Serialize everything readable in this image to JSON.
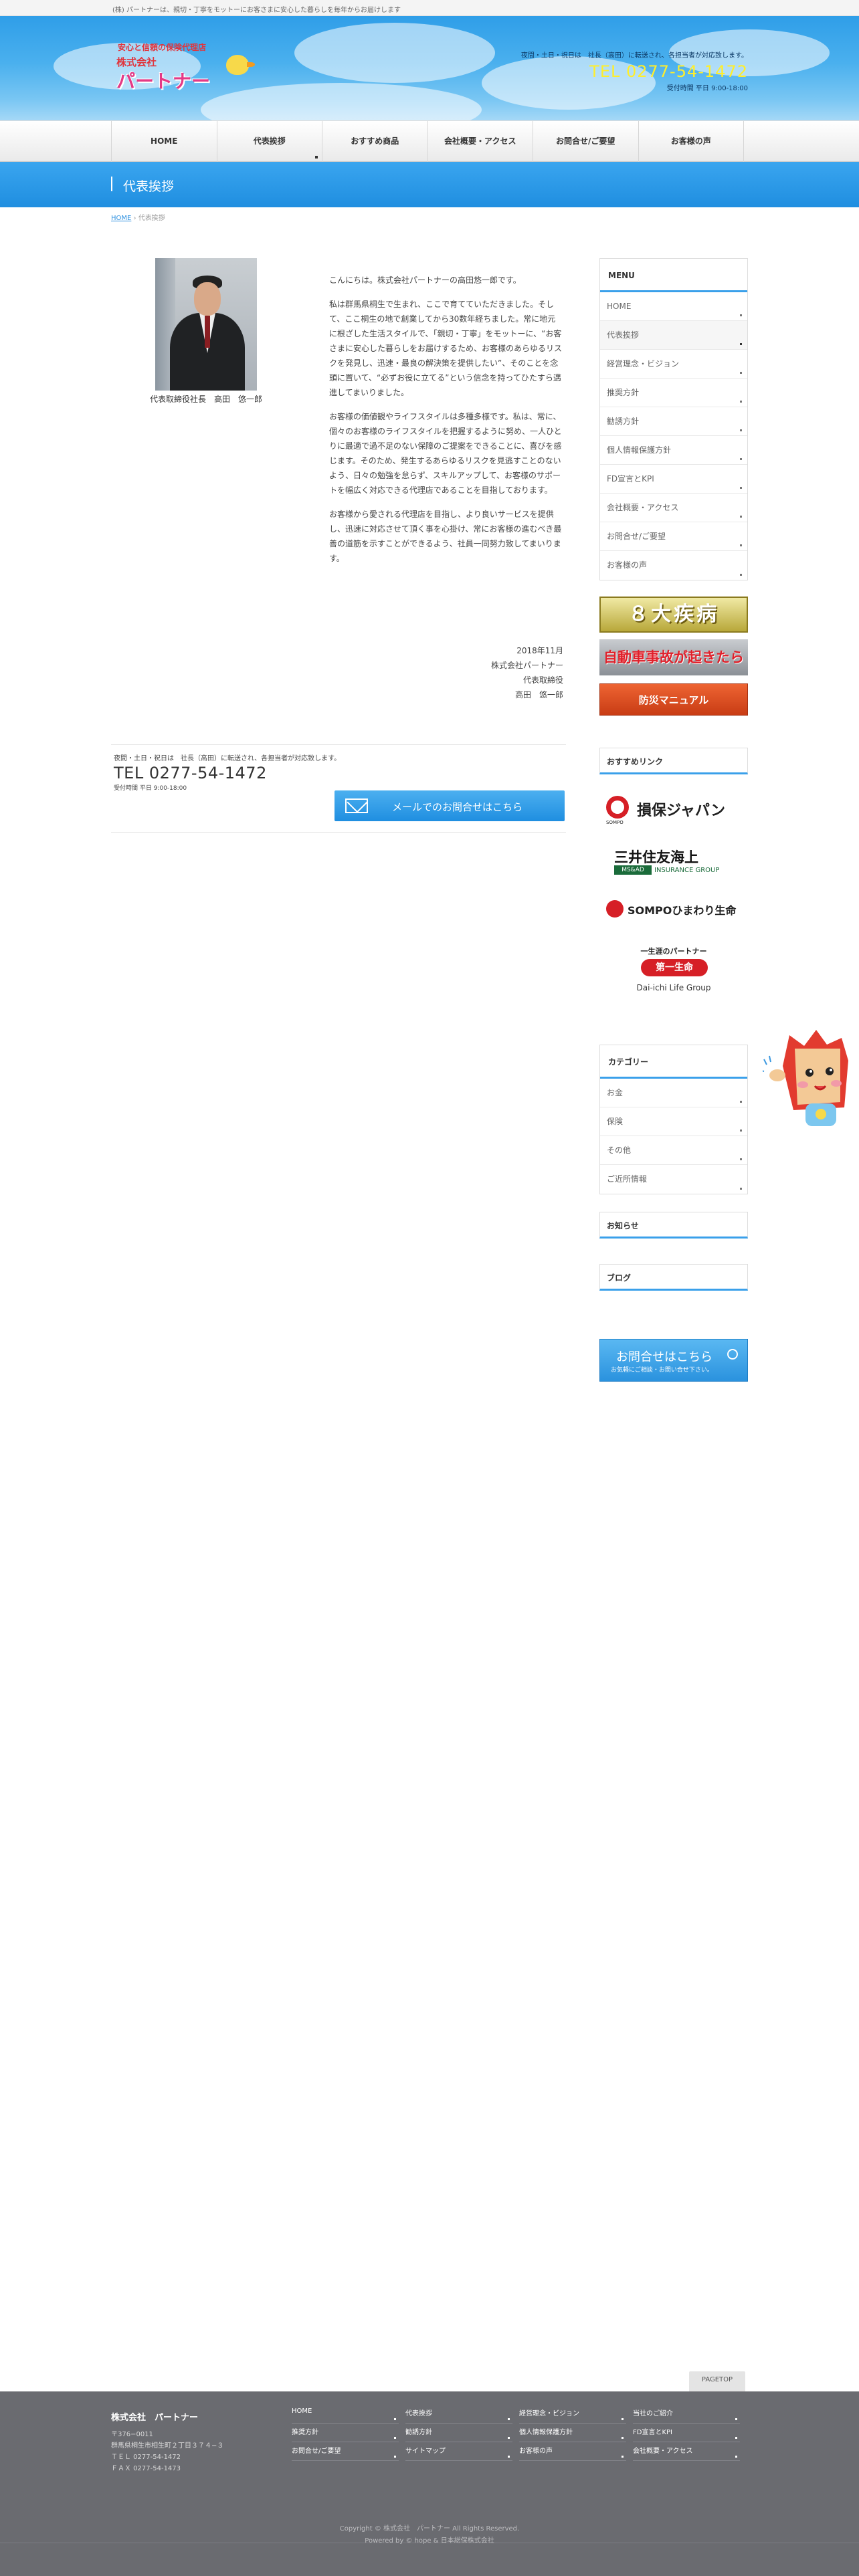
{
  "topbar": {
    "text": "(株) パートナーは、親切・丁寧をモットーにお客さまに安心した暮らしを毎年からお届けします"
  },
  "header": {
    "logo_tag1": "安心と信頼の保険代理店",
    "logo_tag2": "株式会社",
    "logo_name": "パートナー",
    "notice": "夜間・土日・祝日は　社長（高田）に転送され、各担当者が対応致します。",
    "tel": "TEL 0277-54-1472",
    "hours": "受付時間 平日 9:00-18:00"
  },
  "nav": {
    "items": [
      {
        "label": "HOME"
      },
      {
        "label": "代表挨拶"
      },
      {
        "label": "おすすめ商品"
      },
      {
        "label": "会社概要・アクセス"
      },
      {
        "label": "お問合せ/ご要望"
      },
      {
        "label": "お客様の声"
      }
    ]
  },
  "page": {
    "title": "代表挨拶",
    "breadcrumb_home": "HOME",
    "breadcrumb_sep": "›",
    "breadcrumb_current": "代表挨拶"
  },
  "profile": {
    "caption": "代表取締役社長　高田　悠一郎"
  },
  "main": {
    "p1": "こんにちは。株式会社パートナーの高田悠一郎です。",
    "p2": "私は群馬県桐生で生まれ、ここで育てていただきました。そして、ここ桐生の地で創業してから30数年経ちました。常に地元に根ざした生活スタイルで、「親切・丁寧」をモットーに、“お客さまに安心した暮らしをお届けするため、お客様のあらゆるリスクを発見し、迅速・最良の解決策を提供したい”、そのことを念頭に置いて、“必ずお役に立てる”という信念を持ってひたすら邁進してまいりました。",
    "p3": "お客様の価値観やライフスタイルは多種多様です。私は、常に、個々のお客様のライフスタイルを把握するように努め、一人ひとりに最適で過不足のない保障のご提案をできることに、喜びを感じます。そのため、発生するあらゆるリスクを見逃すことのないよう、日々の勉強を怠らず、スキルアップして、お客様のサポートを幅広く対応できる代理店であることを目指しております。",
    "p4": "お客様から愛される代理店を目指し、より良いサービスを提供し、迅速に対応させて頂く事を心掛け、常にお客様の進むべき最善の道筋を示すことができるよう、社員一同努力致してまいります。",
    "date": "2018年11月",
    "company": "株式会社パートナー",
    "role": "代表取締役",
    "name": "高田　悠一郎"
  },
  "contact": {
    "notice": "夜間・土日・祝日は　社長（高田）に転送され、各担当者が対応致します。",
    "tel": "TEL 0277-54-1472",
    "hours": "受付時間 平日 9:00-18:00",
    "mail_button": "メールでのお問合せはこちら"
  },
  "sidebar": {
    "menu_title": "MENU",
    "menu": [
      {
        "label": "HOME"
      },
      {
        "label": "代表挨拶"
      },
      {
        "label": "経営理念・ビジョン"
      },
      {
        "label": "推奨方針"
      },
      {
        "label": "勧誘方針"
      },
      {
        "label": "個人情報保護方針"
      },
      {
        "label": "FD宣言とKPI"
      },
      {
        "label": "会社概要・アクセス"
      },
      {
        "label": "お問合せ/ご要望"
      },
      {
        "label": "お客様の声"
      }
    ],
    "banner_8": "８大疾病",
    "banner_auto": "自動車事故が起きたら",
    "banner_disaster": "防災マニュアル",
    "links_title": "おすすめリンク",
    "sompo": "損保ジャパン",
    "sompo_sub": "SOMPO",
    "mitsui": "三井住友海上",
    "mitsui_badge": "MS&AD",
    "mitsui_sub": "INSURANCE GROUP",
    "himawari": "SOMPOひまわり生命",
    "daiichi_top": "一生涯のパートナー",
    "daiichi_mid": "第一生命",
    "daiichi_bottom": "Dai-ichi Life Group",
    "category_title": "カテゴリー",
    "categories": [
      {
        "label": "お金"
      },
      {
        "label": "保険"
      },
      {
        "label": "その他"
      },
      {
        "label": "ご近所情報"
      }
    ],
    "news_title": "お知らせ",
    "blog_title": "ブログ",
    "inquiry_title": "お問合せはこちら",
    "inquiry_sub": "お気軽にご相談・お問い合せ下さい。"
  },
  "pagetop": "PAGETOP",
  "footer": {
    "company": "株式会社　パートナー",
    "addr1": "〒376−0011",
    "addr2": "群馬県桐生市相生町２丁目３７４−３",
    "addr3": "ＴＥＬ 0277-54-1472",
    "addr4": "ＦＡＸ 0277-54-1473",
    "links": [
      {
        "label": "HOME"
      },
      {
        "label": "代表挨拶"
      },
      {
        "label": "経営理念・ビジョン"
      },
      {
        "label": "当社のご紹介"
      },
      {
        "label": "推奨方針"
      },
      {
        "label": "勧誘方針"
      },
      {
        "label": "個人情報保護方針"
      },
      {
        "label": "FD宣言とKPI"
      },
      {
        "label": "お問合せ/ご要望"
      },
      {
        "label": "サイトマップ"
      },
      {
        "label": "お客様の声"
      },
      {
        "label": "会社概要・アクセス"
      }
    ],
    "copyright": "Copyright © 株式会社　パートナー All Rights Reserved.",
    "powered": "Powered by © hope & 日本総保株式会社"
  }
}
